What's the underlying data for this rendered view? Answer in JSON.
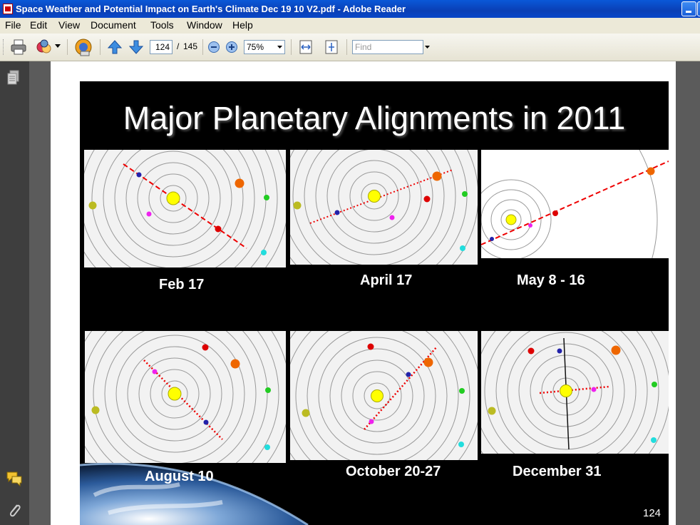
{
  "window": {
    "title": "Space Weather and Potential Impact on Earth's Climate Dec 19 10 V2.pdf - Adobe Reader"
  },
  "menu": [
    "File",
    "Edit",
    "View",
    "Document",
    "Tools",
    "Window",
    "Help"
  ],
  "toolbar": {
    "current_page": "124",
    "page_separator": "/",
    "total_pages": "145",
    "zoom": "75%",
    "find_placeholder": "Find"
  },
  "slide": {
    "title": "Major Planetary Alignments in 2011",
    "page_number": "124",
    "captions": [
      "Feb 17",
      "April 17",
      "May 8 - 16",
      "August 10",
      "October 20-27",
      "December 31"
    ]
  },
  "colors": {
    "titlebar": "#0a4fd0",
    "slide_bg": "#000000",
    "alignment_line": "#e00000",
    "sun": "#ffff00"
  },
  "icons": [
    "print-icon",
    "create-pdf-icon",
    "collaborate-icon",
    "previous-page-icon",
    "next-page-icon",
    "zoom-out-icon",
    "zoom-in-icon",
    "fit-width-icon",
    "fit-page-icon",
    "pages-panel-icon",
    "comments-icon",
    "attachments-icon"
  ]
}
